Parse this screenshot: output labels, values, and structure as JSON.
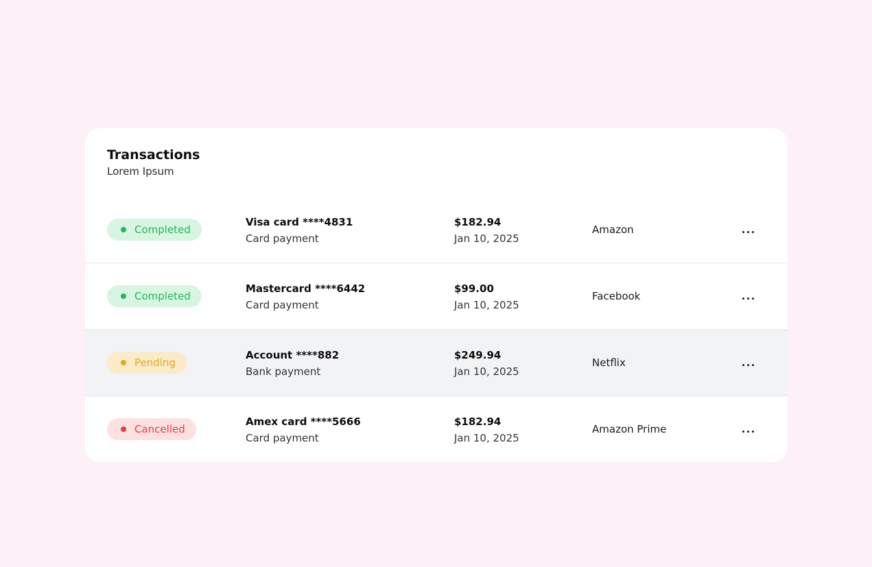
{
  "card": {
    "title": "Transactions",
    "subtitle": "Lorem Ipsum"
  },
  "transactions": [
    {
      "status": "Completed",
      "status_type": "completed",
      "method": "Visa card ****4831",
      "method_type": "Card payment",
      "amount": "$182.94",
      "date": "Jan 10, 2025",
      "merchant": "Amazon",
      "more_icon": "more-horizontal-icon"
    },
    {
      "status": "Completed",
      "status_type": "completed",
      "method": "Mastercard ****6442",
      "method_type": "Card payment",
      "amount": "$99.00",
      "date": "Jan 10, 2025",
      "merchant": "Facebook",
      "more_icon": "more-horizontal-icon"
    },
    {
      "status": "Pending",
      "status_type": "pending",
      "method": "Account ****882",
      "method_type": "Bank payment",
      "amount": "$249.94",
      "date": "Jan 10, 2025",
      "merchant": "Netflix",
      "more_icon": "more-horizontal-icon",
      "highlighted": true
    },
    {
      "status": "Cancelled",
      "status_type": "cancelled",
      "method": "Amex card ****5666",
      "method_type": "Card payment",
      "amount": "$182.94",
      "date": "Jan 10, 2025",
      "merchant": "Amazon Prime",
      "more_icon": "more-horizontal-icon"
    }
  ],
  "colors": {
    "page_background": "#fdf0f6",
    "completed": "#22b55a",
    "pending": "#e2aa18",
    "cancelled": "#e53e3e",
    "highlight_row": "#f2f3f5"
  }
}
